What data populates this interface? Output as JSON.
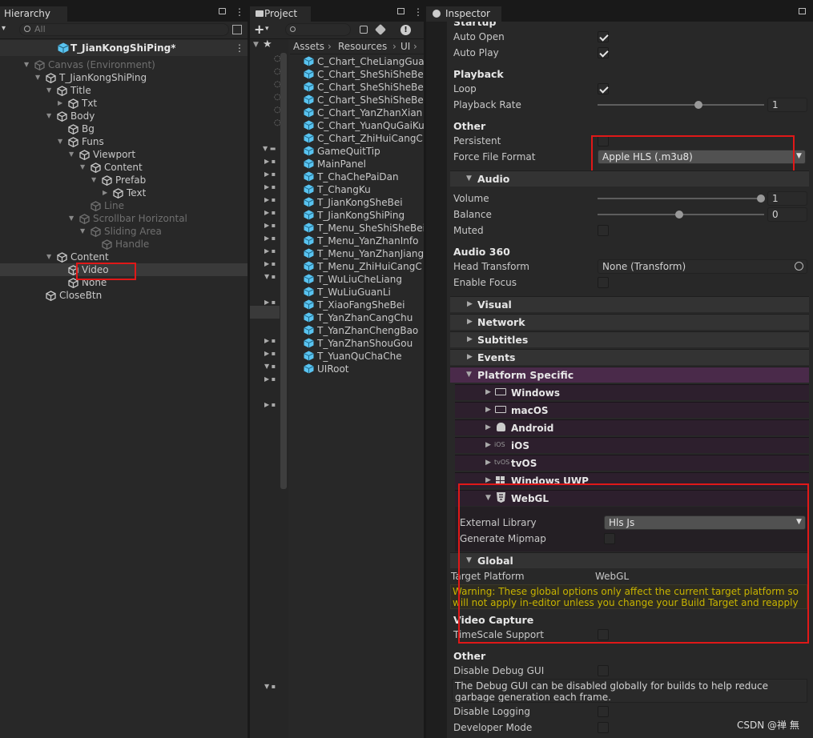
{
  "hierarchy": {
    "tab": "Hierarchy",
    "search_placeholder": "All",
    "scene": "T_JianKongShiPing*",
    "items": [
      {
        "label": "Canvas (Environment)",
        "depth": 0,
        "arrow": "down",
        "dim": true
      },
      {
        "label": "T_JianKongShiPing",
        "depth": 1,
        "arrow": "down",
        "dim": false
      },
      {
        "label": "Title",
        "depth": 2,
        "arrow": "down",
        "dim": false
      },
      {
        "label": "Txt",
        "depth": 3,
        "arrow": "right",
        "dim": false
      },
      {
        "label": "Body",
        "depth": 2,
        "arrow": "down",
        "dim": false
      },
      {
        "label": "Bg",
        "depth": 3,
        "arrow": "",
        "dim": false
      },
      {
        "label": "Funs",
        "depth": 3,
        "arrow": "down",
        "dim": false
      },
      {
        "label": "Viewport",
        "depth": 4,
        "arrow": "down",
        "dim": false
      },
      {
        "label": "Content",
        "depth": 5,
        "arrow": "down",
        "dim": false
      },
      {
        "label": "Prefab",
        "depth": 6,
        "arrow": "down",
        "dim": false
      },
      {
        "label": "Text",
        "depth": 7,
        "arrow": "right",
        "dim": false
      },
      {
        "label": "Line",
        "depth": 5,
        "arrow": "",
        "dim": true
      },
      {
        "label": "Scrollbar Horizontal",
        "depth": 4,
        "arrow": "down",
        "dim": true
      },
      {
        "label": "Sliding Area",
        "depth": 5,
        "arrow": "down",
        "dim": true
      },
      {
        "label": "Handle",
        "depth": 6,
        "arrow": "",
        "dim": true
      },
      {
        "label": "Content",
        "depth": 2,
        "arrow": "down",
        "dim": false
      },
      {
        "label": "Video",
        "depth": 3,
        "arrow": "",
        "dim": false
      },
      {
        "label": "None",
        "depth": 3,
        "arrow": "",
        "dim": false
      },
      {
        "label": "CloseBtn",
        "depth": 1,
        "arrow": "",
        "dim": false
      }
    ]
  },
  "project": {
    "tab": "Project",
    "breadcrumb": [
      "Assets",
      "Resources",
      "UI"
    ],
    "files": [
      "C_Chart_CheLiangGuan",
      "C_Chart_SheShiSheBei",
      "C_Chart_SheShiSheBei",
      "C_Chart_SheShiSheBei",
      "C_Chart_YanZhanXian",
      "C_Chart_YuanQuGaiKu",
      "C_Chart_ZhiHuiCangC",
      "GameQuitTip",
      "MainPanel",
      "T_ChaChePaiDan",
      "T_ChangKu",
      "T_JianKongSheBei",
      "T_JianKongShiPing",
      "T_Menu_SheShiSheBei",
      "T_Menu_YanZhanInfo",
      "T_Menu_YanZhanJiang",
      "T_Menu_ZhiHuiCangC",
      "T_WuLiuCheLiang",
      "T_WuLiuGuanLi",
      "T_XiaoFangSheBei",
      "T_YanZhanCangChu",
      "T_YanZhanChengBao",
      "T_YanZhanShouGou",
      "T_YuanQuChaChe",
      "UIRoot"
    ]
  },
  "inspector": {
    "tab": "Inspector",
    "startup": {
      "title": "Startup",
      "auto_open": "Auto Open",
      "auto_play": "Auto Play"
    },
    "playback": {
      "title": "Playback",
      "loop": "Loop",
      "rate": "Playback Rate",
      "rate_value": "1",
      "rate_slider": 0.62
    },
    "other": {
      "title": "Other",
      "persistent": "Persistent",
      "force_format": "Force File Format",
      "format_value": "Apple HLS (.m3u8)"
    },
    "audio": {
      "title": "Audio",
      "volume": "Volume",
      "volume_value": "1",
      "volume_slider": 1.0,
      "balance": "Balance",
      "balance_value": "0",
      "balance_slider": 0.5,
      "muted": "Muted"
    },
    "audio360": {
      "title": "Audio 360",
      "head": "Head Transform",
      "head_value": "None (Transform)",
      "focus": "Enable Focus"
    },
    "sections": [
      "Visual",
      "Network",
      "Subtitles",
      "Events"
    ],
    "platform": {
      "title": "Platform Specific",
      "items": [
        "Windows",
        "macOS",
        "Android",
        "iOS",
        "tvOS",
        "Windows UWP"
      ],
      "ios_tag": "iOS",
      "tvos_tag": "tvOS"
    },
    "webgl": {
      "title": "WebGL",
      "ext_lib": "External Library",
      "ext_value": "Hls Js",
      "mipmap": "Generate Mipmap"
    },
    "global": {
      "title": "Global",
      "target": "Target Platform",
      "target_value": "WebGL",
      "warning": "Warning: These global options only affect the current target platform so will not apply in-editor unless you change your Build Target and reapply them.",
      "capture": "Video Capture",
      "timescale": "TimeScale Support",
      "other": "Other",
      "debug_gui": "Disable Debug GUI",
      "debug_note": "The Debug GUI can be disabled globally for builds to help reduce garbage generation each frame.",
      "disable_logging": "Disable Logging",
      "developer": "Developer Mode"
    }
  },
  "watermark": "CSDN @禅 無",
  "colors": {
    "accent": "#4a2a4a",
    "cube": "#59c3f0",
    "highlight": "#e01818",
    "warning": "#c8b400"
  }
}
